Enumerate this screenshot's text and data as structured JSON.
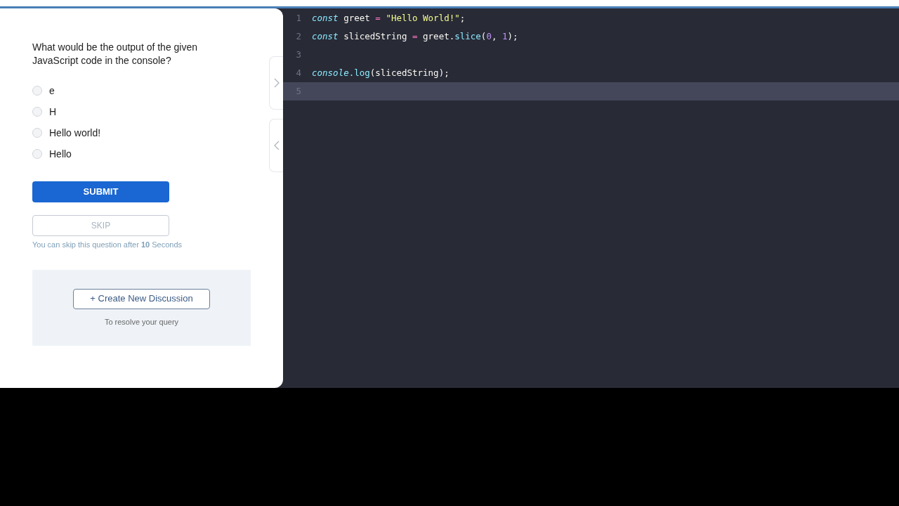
{
  "question": {
    "text": "What would be the output of the given JavaScript code in the console?",
    "options": [
      {
        "label": "e",
        "selected": false
      },
      {
        "label": "H",
        "selected": false
      },
      {
        "label": "Hello world!",
        "selected": false
      },
      {
        "label": "Hello",
        "selected": false
      }
    ]
  },
  "submit_button": "SUBMIT",
  "skip_button": {
    "label": "SKIP",
    "disabled": true
  },
  "skip_note": "You can skip this question after **10** Seconds",
  "discussion": {
    "button": "+ Create New Discussion",
    "caption": "To resolve your query"
  },
  "editor": {
    "lines": [
      {
        "number": "1",
        "active": false,
        "tokens": [
          {
            "kind": "keyword",
            "text": "const"
          },
          {
            "kind": "plain",
            "text": " greet "
          },
          {
            "kind": "operator",
            "text": "="
          },
          {
            "kind": "string",
            "text": " \"Hello World!\""
          },
          {
            "kind": "plain",
            "text": ";"
          }
        ]
      },
      {
        "number": "2",
        "active": false,
        "tokens": [
          {
            "kind": "keyword",
            "text": "const"
          },
          {
            "kind": "plain",
            "text": " slicedString "
          },
          {
            "kind": "operator",
            "text": "="
          },
          {
            "kind": "plain",
            "text": " greet."
          },
          {
            "kind": "function",
            "text": "slice"
          },
          {
            "kind": "plain",
            "text": "("
          },
          {
            "kind": "number",
            "text": "0"
          },
          {
            "kind": "plain",
            "text": ", "
          },
          {
            "kind": "number",
            "text": "1"
          },
          {
            "kind": "plain",
            "text": ");"
          }
        ]
      },
      {
        "number": "3",
        "active": false
      },
      {
        "number": "4",
        "active": false,
        "tokens": [
          {
            "kind": "keyword",
            "text": "console"
          },
          {
            "kind": "function",
            "text": ".log"
          },
          {
            "kind": "plain",
            "text": "(slicedString);"
          }
        ]
      },
      {
        "number": "5",
        "active": true
      }
    ]
  }
}
